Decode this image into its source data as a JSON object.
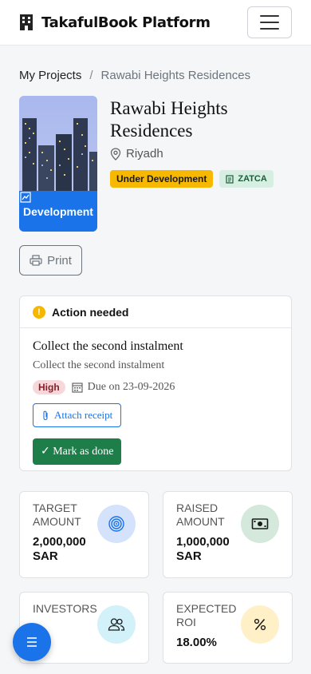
{
  "app": {
    "brand": "TakafulBook Platform",
    "icons": {
      "brand": "building-icon",
      "menu": "hamburger-menu-icon"
    }
  },
  "breadcrumb": {
    "root": "My Projects",
    "separator": "/",
    "current": "Rawabi Heights Residences"
  },
  "project": {
    "title": "Rawabi Heights Residences",
    "location": "Riyadh",
    "category": "Development",
    "status_badge": "Under Development",
    "zatca_badge": "ZATCA",
    "colors": {
      "status": "#f6b800",
      "zatca_bg": "#d7efe2",
      "category_bg": "#1a73e8"
    }
  },
  "toolbar": {
    "print_label": "Print"
  },
  "action": {
    "header": "Action needed",
    "task_title": "Collect the second instalment",
    "task_description": "Collect the second instalment",
    "priority": "High",
    "due": "Due on 23-09-2026",
    "attach_label": "Attach receipt",
    "done_label": "✓ Mark as done",
    "colors": {
      "done_button": "#1e7e4a",
      "priority_bg": "#f8d7da"
    }
  },
  "stats": [
    {
      "label": "TARGET AMOUNT",
      "value": "2,000,000 SAR",
      "icon": "target-icon",
      "icon_bg": "#d4e3fb"
    },
    {
      "label": "RAISED AMOUNT",
      "value": "1,000,000 SAR",
      "icon": "cash-icon",
      "icon_bg": "#d5e8dc"
    },
    {
      "label": "INVESTORS",
      "value": "",
      "icon": "people-icon",
      "icon_bg": "#d3f1f8"
    },
    {
      "label": "EXPECTED ROI",
      "value": "18.00%",
      "icon": "percent-icon",
      "icon_bg": "#fff0c7"
    }
  ],
  "fab": {
    "icon": "list-icon"
  }
}
